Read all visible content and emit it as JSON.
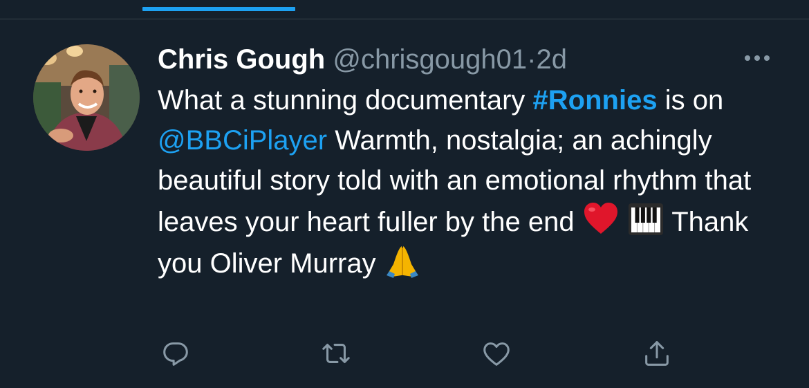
{
  "tweet": {
    "author_name": "Chris Gough",
    "author_handle": "@chrisgough01",
    "separator": "·",
    "time": "2d",
    "text": {
      "part1": "What a stunning documentary ",
      "hashtag": "#Ronnies",
      "part2": " is on ",
      "mention": "@BBCiPlayer",
      "part3": " Warmth, nostalgia; an achingly beautiful story told with an emotional rhythm that leaves your heart fuller by the end ",
      "part4": " Thank you Oliver Murray "
    },
    "emojis": [
      "red-heart",
      "musical-keyboard",
      "folded-hands"
    ]
  },
  "colors": {
    "background": "#15202b",
    "accent": "#1da1f2",
    "secondary_text": "#8899a6",
    "divider": "#38444d"
  },
  "actions": [
    "reply-icon",
    "retweet-icon",
    "like-icon",
    "share-icon"
  ]
}
